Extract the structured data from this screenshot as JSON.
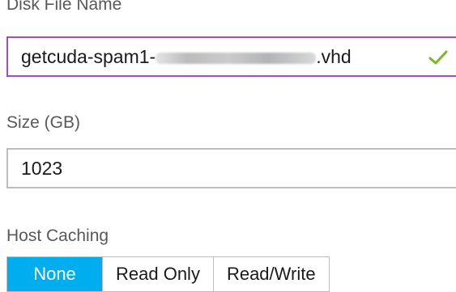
{
  "disk_file_name": {
    "label": "Disk File Name",
    "value_prefix": "getcuda-spam1-",
    "value_suffix": ".vhd",
    "valid_icon": "check-icon"
  },
  "size": {
    "label": "Size (GB)",
    "value": "1023"
  },
  "host_caching": {
    "label": "Host Caching",
    "options": [
      "None",
      "Read Only",
      "Read/Write"
    ],
    "selected": "None"
  },
  "colors": {
    "accent_selected": "#00aeef",
    "valid_border": "#a14fc0",
    "check": "#78b82a"
  }
}
